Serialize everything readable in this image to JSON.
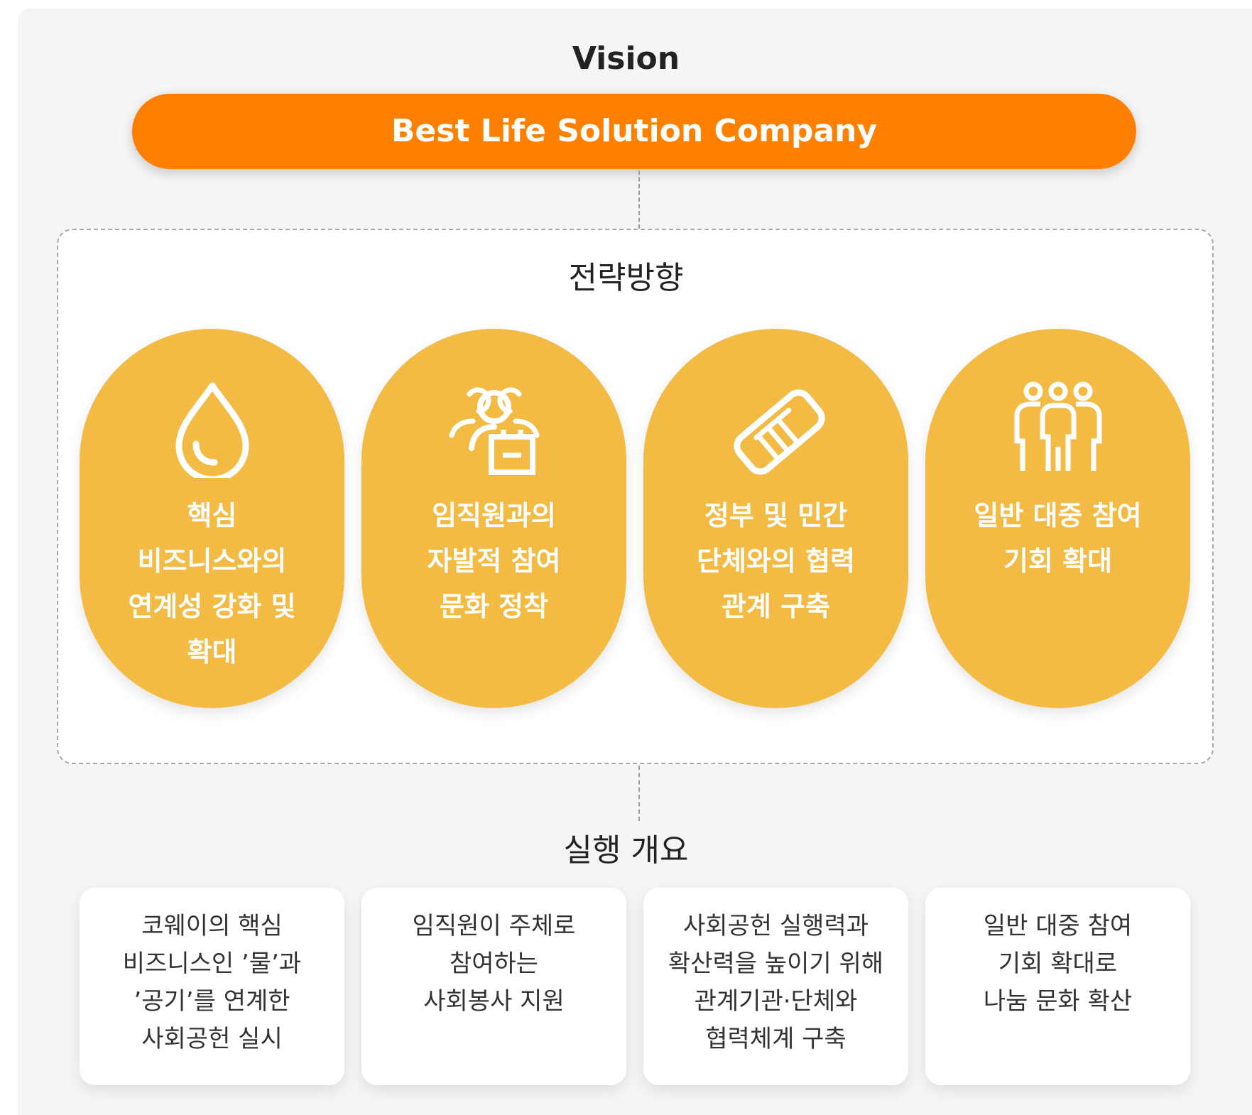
{
  "vision": {
    "title": "Vision",
    "statement": "Best Life Solution Company"
  },
  "strategy": {
    "title": "전략방향",
    "items": [
      {
        "icon": "water-drop-icon",
        "lines": [
          "핵심",
          "비즈니스와의",
          "연계성 강화 및",
          "확대"
        ]
      },
      {
        "icon": "volunteer-group-icon",
        "lines": [
          "임직원과의",
          "자발적 참여",
          "문화 정착"
        ]
      },
      {
        "icon": "handshake-icon",
        "lines": [
          "정부 및 민간",
          "단체와의 협력",
          "관계 구축"
        ]
      },
      {
        "icon": "people-group-icon",
        "lines": [
          "일반 대중 참여",
          "기회 확대"
        ]
      }
    ]
  },
  "execution": {
    "title": "실행 개요",
    "items": [
      {
        "lines": [
          "코웨이의 핵심",
          "비즈니스인 ’물’과",
          "’공기’를 연계한",
          "사회공헌 실시"
        ]
      },
      {
        "lines": [
          "임직원이 주체로",
          "참여하는",
          "사회봉사 지원"
        ]
      },
      {
        "lines": [
          "사회공헌 실행력과",
          "확산력을 높이기 위해",
          "관계기관·단체와",
          "협력체계 구축"
        ]
      },
      {
        "lines": [
          "일반 대중 참여",
          "기회 확대로",
          "나눔 문화 확산"
        ]
      }
    ]
  },
  "colors": {
    "vision_pill": "#ff7f00",
    "strategy_circle": "#f4bb44",
    "background_panel": "#f5f5f5"
  }
}
